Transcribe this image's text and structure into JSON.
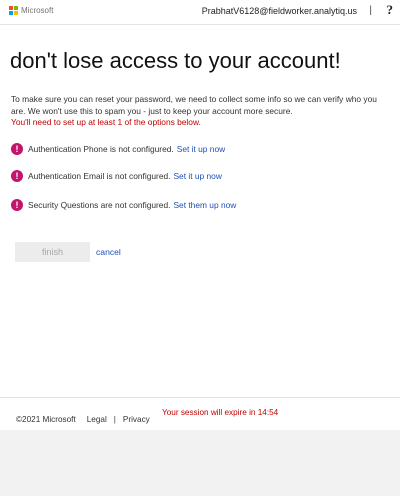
{
  "header": {
    "brand": "Microsoft",
    "user_email": "PrabhatV6128@fieldworker.analytiq.us",
    "divider": "|",
    "help_symbol": "?"
  },
  "main": {
    "title": "don't lose access to your account!",
    "intro": "To make sure you can reset your password, we need to collect some info so we can verify who you are. We won't use this to spam you - just to keep your account more secure.",
    "warning": "You'll need to set up at least 1 of the options below.",
    "requirements": [
      {
        "text": "Authentication Phone is not configured.",
        "link": "Set it up now"
      },
      {
        "text": "Authentication Email is not configured.",
        "link": "Set it up now"
      },
      {
        "text": "Security Questions are not configured.",
        "link": "Set them up now"
      }
    ],
    "alert_symbol": "!",
    "finish_label": "finish",
    "cancel_label": "cancel"
  },
  "footer": {
    "copyright": "©2021 Microsoft",
    "legal": "Legal",
    "separator": "|",
    "privacy": "Privacy",
    "session": "Your session will expire in 14:54"
  },
  "colors": {
    "logo_red": "#f25022",
    "logo_green": "#7fba00",
    "logo_blue": "#00a4ef",
    "logo_yellow": "#ffb900",
    "alert": "#c0166c",
    "link": "#1e4fb8",
    "warning": "#c00000"
  }
}
